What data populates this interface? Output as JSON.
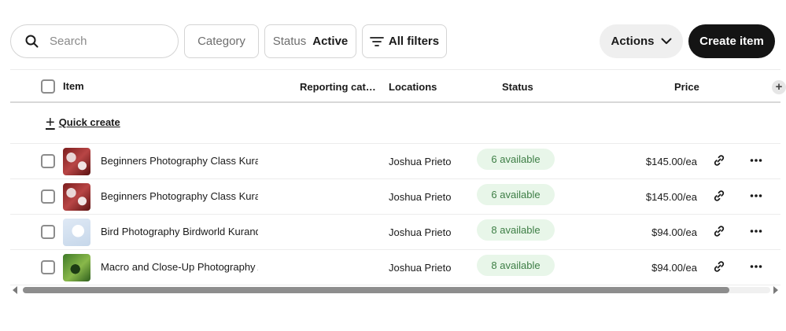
{
  "toolbar": {
    "search_placeholder": "Search",
    "category_label": "Category",
    "status_key": "Status",
    "status_value": "Active",
    "all_filters_label": "All filters",
    "actions_label": "Actions",
    "create_label": "Create item"
  },
  "table": {
    "columns": {
      "item": "Item",
      "reporting": "Reporting categ...",
      "locations": "Locations",
      "status": "Status",
      "price": "Price"
    },
    "add_column_symbol": "+",
    "quick_create_label": "Quick create",
    "rows": [
      {
        "name": "Beginners Photography Class Kuranda",
        "location": "Joshua Prieto",
        "status": "6 available",
        "price": "$145.00/ea",
        "thumb": "red"
      },
      {
        "name": "Beginners Photography Class Kuranda",
        "location": "Joshua Prieto",
        "status": "6 available",
        "price": "$145.00/ea",
        "thumb": "red"
      },
      {
        "name": "Bird Photography Birdworld Kuranda",
        "location": "Joshua Prieto",
        "status": "8 available",
        "price": "$94.00/ea",
        "thumb": "bird"
      },
      {
        "name": "Macro and Close-Up Photography A",
        "location": "Joshua Prieto",
        "status": "8 available",
        "price": "$94.00/ea",
        "thumb": "green"
      }
    ]
  },
  "icons": {
    "search": "search-icon",
    "filter": "filter-lines-icon",
    "chevron": "chevron-down-icon",
    "link": "link-icon",
    "more": "more-horizontal-icon"
  },
  "colors": {
    "primary_button": "#141414",
    "secondary_button": "#efefef",
    "badge_bg": "#e8f6e9",
    "badge_text": "#3d7e45"
  }
}
